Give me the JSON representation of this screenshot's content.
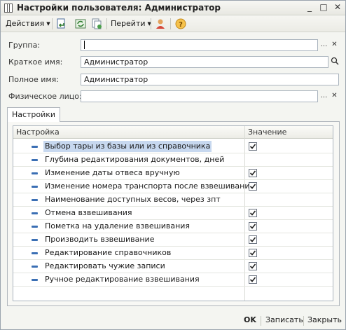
{
  "window": {
    "title": "Настройки пользователя: Администратор",
    "controls": {
      "minimize": "_",
      "maximize": "□",
      "close": "✕"
    }
  },
  "toolbar": {
    "actions_label": "Действия",
    "goto_label": "Перейти",
    "help_icon_text": "?",
    "icons": [
      "save-close-icon",
      "refresh-icon",
      "copy-icon",
      "user-icon",
      "help-icon"
    ]
  },
  "form": {
    "group": {
      "label": "Группа:",
      "value": "",
      "btn_select": "...",
      "btn_clear": "✕"
    },
    "short_name": {
      "label": "Краткое имя:",
      "value": "Администратор"
    },
    "full_name": {
      "label": "Полное имя:",
      "value": "Администратор"
    },
    "person": {
      "label": "Физическое лицо:",
      "value": "",
      "btn_select": "...",
      "btn_clear": "✕"
    }
  },
  "tabs": [
    {
      "label": "Настройки"
    }
  ],
  "settings_table": {
    "columns": [
      "Настройка",
      "Значение"
    ],
    "rows": [
      {
        "name": "Выбор тары из базы или из справочника",
        "checked": true,
        "selected": true
      },
      {
        "name": "Глубина редактирования документов, дней",
        "checked": false,
        "has_checkbox": false
      },
      {
        "name": "Изменение даты отвеса вручную",
        "checked": true
      },
      {
        "name": "Изменение номера транспорта после взвешивания",
        "checked": true
      },
      {
        "name": "Наименование доступных весов, через зпт",
        "checked": false,
        "has_checkbox": false
      },
      {
        "name": "Отмена взвешивания",
        "checked": true
      },
      {
        "name": "Пометка на удаление взвешивания",
        "checked": true
      },
      {
        "name": "Производить взвешивание",
        "checked": true
      },
      {
        "name": "Редактирование справочников",
        "checked": true
      },
      {
        "name": "Редактировать чужие записи",
        "checked": true
      },
      {
        "name": "Ручное редактирование взвешивания",
        "checked": true
      }
    ]
  },
  "footer": {
    "ok": "OK",
    "save": "Записать",
    "close": "Закрыть"
  },
  "colors": {
    "accent": "#3b6fb4",
    "selection": "#c7d8ef",
    "help": "#e5a12a"
  }
}
